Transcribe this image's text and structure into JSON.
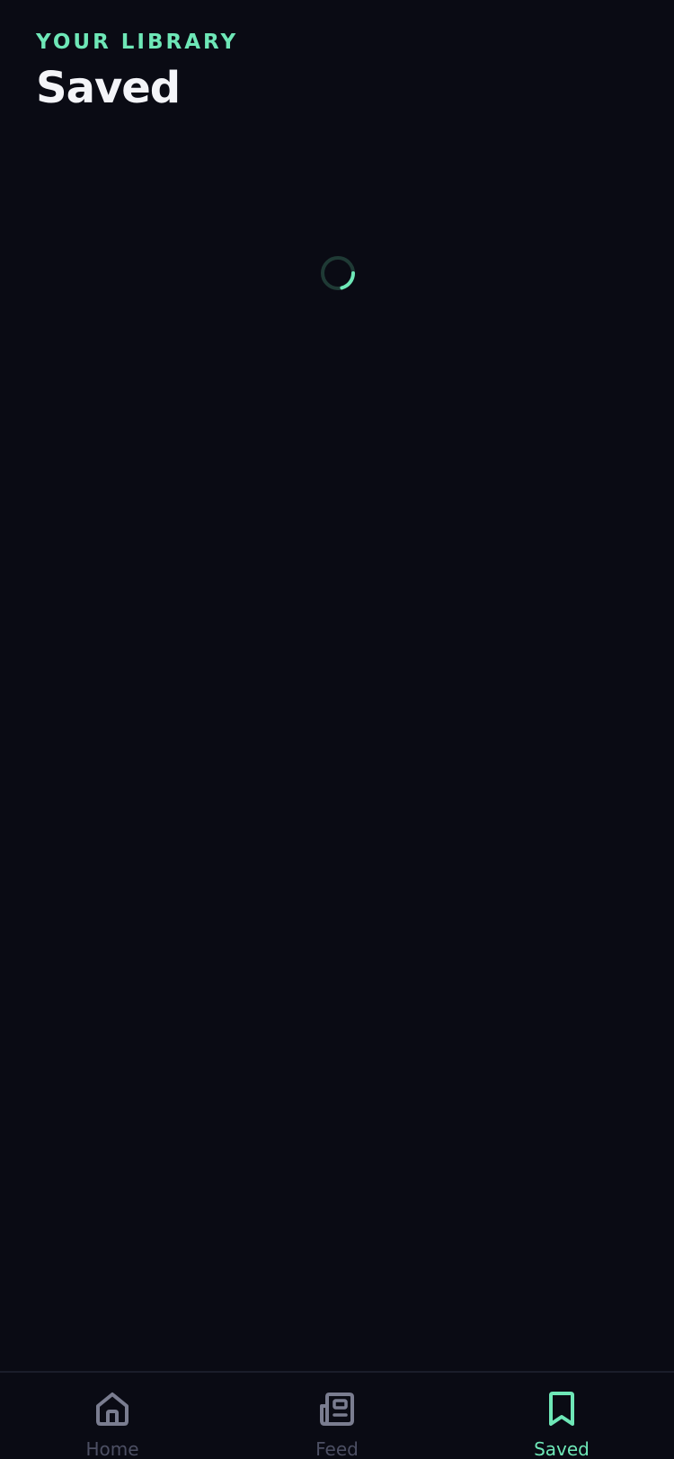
{
  "header": {
    "eyebrow": "YOUR LIBRARY",
    "title": "Saved"
  },
  "status": {
    "loading": true
  },
  "tabs": [
    {
      "label": "Home",
      "icon": "home-icon",
      "active": false
    },
    {
      "label": "Feed",
      "icon": "newspaper-icon",
      "active": false
    },
    {
      "label": "Saved",
      "icon": "bookmark-icon",
      "active": true
    }
  ],
  "colors": {
    "background": "#0a0b14",
    "accent": "#6ee7b7",
    "title": "#f3f4f8",
    "inactive_icon": "#7a7d90",
    "inactive_label": "#4c4f63",
    "spinner_track": "#1f3a35"
  }
}
